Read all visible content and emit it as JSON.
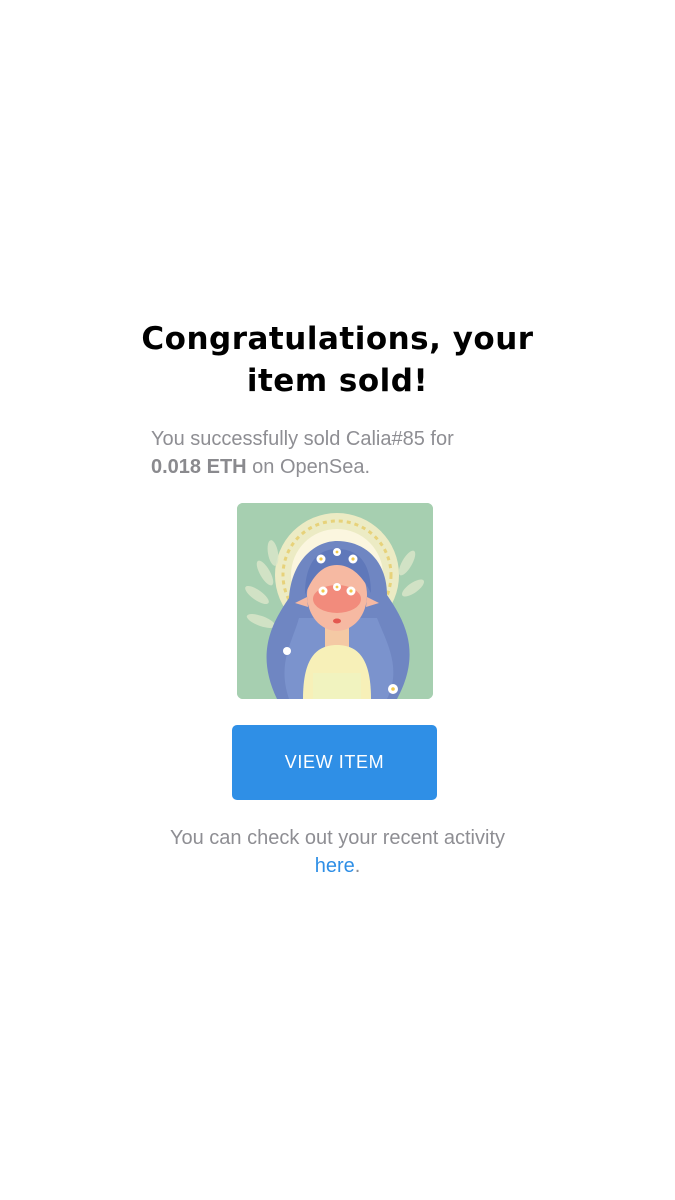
{
  "headline": {
    "line1": "Congratulations, your",
    "line2": "item sold!"
  },
  "message": {
    "prefix": "You successfully sold Calia#85 for",
    "price": "0.018 ETH",
    "suffix": "on OpenSea."
  },
  "item": {
    "name": "Calia#85",
    "image": "nft-artwork-girl-with-flowers"
  },
  "view_button": {
    "label": "VIEW ITEM",
    "color": "#2f8fe6"
  },
  "footer": {
    "text": "You can check out your recent activity",
    "link_label": "here",
    "period": "."
  },
  "colors": {
    "background": "#ffffff",
    "muted_text": "#8e8e93",
    "link": "#2f8fe6",
    "art_background": "#a6cfb0"
  }
}
